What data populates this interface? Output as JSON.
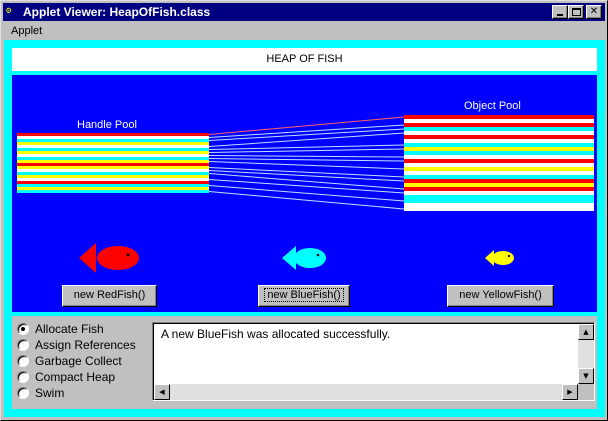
{
  "window": {
    "icon": "applet-icon",
    "title": "Applet Viewer: HeapOfFish.class",
    "controls": {
      "minimize": "minimize-icon",
      "maximize": "maximize-icon",
      "close": "✕"
    }
  },
  "menu": {
    "items": [
      "Applet"
    ]
  },
  "applet": {
    "title": "HEAP OF FISH",
    "handle_pool_label": "Handle Pool",
    "object_pool_label": "Object Pool",
    "buttons": {
      "red": "new RedFish()",
      "blue": "new BlueFish()",
      "yellow": "new YellowFish()"
    },
    "modes": [
      {
        "label": "Allocate Fish",
        "selected": true
      },
      {
        "label": "Assign References",
        "selected": false
      },
      {
        "label": "Garbage Collect",
        "selected": false
      },
      {
        "label": "Compact Heap",
        "selected": false
      },
      {
        "label": "Swim",
        "selected": false
      }
    ],
    "message": "A new BlueFish was allocated successfully.",
    "colors": {
      "background": "#00ffff",
      "panel": "#0000ff",
      "red_fish": "#ff0000",
      "blue_fish": "#00ffff",
      "yellow_fish": "#ffff00"
    },
    "handle_pool_stripes": [
      "#ff0000",
      "#ffffff",
      "#00ffff",
      "#ffff00",
      "#ffffff",
      "#00ffff",
      "#ffff00",
      "#ffffff",
      "#00ffff",
      "#ffff00",
      "#ff0000",
      "#ffff00",
      "#ffffff",
      "#00ffff",
      "#ffff00",
      "#ffffff",
      "#ff0000",
      "#00ffff",
      "#ffff00",
      "#00ffff"
    ],
    "object_pool_stripes": [
      "#ff0000",
      "#ffffff",
      "#ff0000",
      "#00ffff",
      "#ffffff",
      "#ff0000",
      "#ffffff",
      "#00ffff",
      "#ffff00",
      "#00ffff",
      "#ffffff",
      "#ff0000",
      "#ffffff",
      "#ffff00",
      "#ffffff",
      "#00ffff",
      "#ff0000",
      "#ffff00",
      "#ff0000",
      "#ffffff",
      "#00ffff",
      "#00ffff",
      "#ffffff",
      "#ffffff"
    ]
  }
}
